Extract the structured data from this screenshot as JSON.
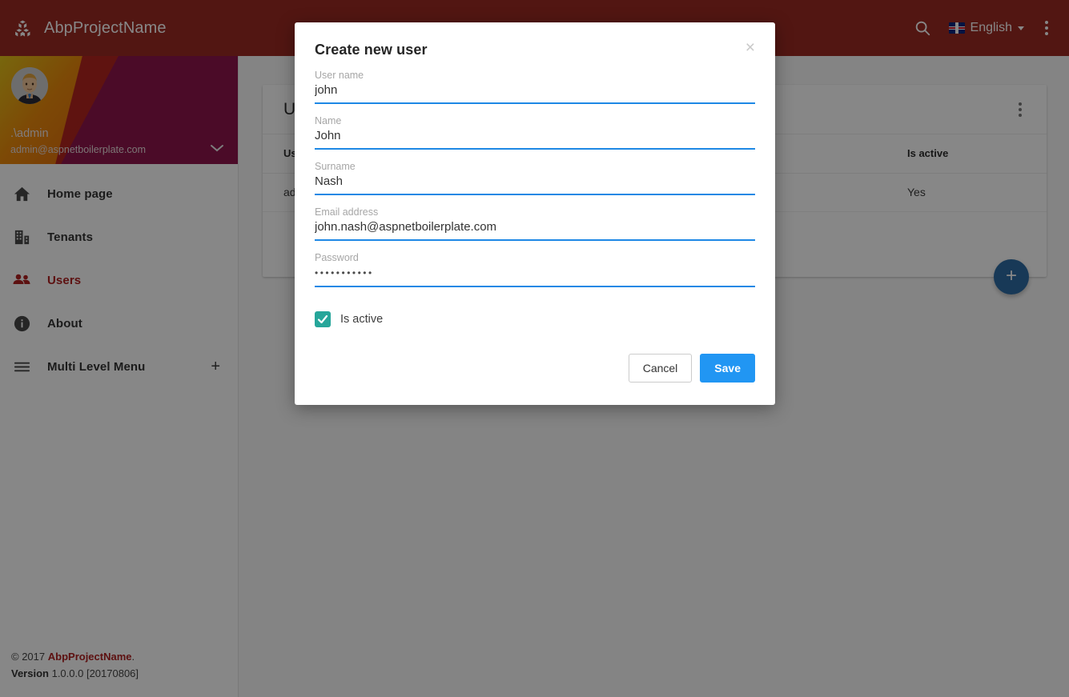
{
  "header": {
    "brand": "AbpProjectName",
    "brand_icon": "cubes-icon",
    "search_icon": "search-icon",
    "language": "English",
    "language_flag": "uk-flag-icon",
    "menu_icon": "kebab-menu-icon"
  },
  "sidebar": {
    "user": {
      "name": ".\\admin",
      "email": "admin@aspnetboilerplate.com",
      "avatar": "user-avatar",
      "expand_icon": "chevron-down-icon"
    },
    "items": [
      {
        "label": "Home page",
        "icon": "home-icon",
        "active": false
      },
      {
        "label": "Tenants",
        "icon": "building-icon",
        "active": false
      },
      {
        "label": "Users",
        "icon": "people-icon",
        "active": true
      },
      {
        "label": "About",
        "icon": "info-circle-icon",
        "active": false
      },
      {
        "label": "Multi Level Menu",
        "icon": "hamburger-icon",
        "active": false,
        "expander": "+"
      }
    ],
    "footer": {
      "copyright_prefix": "© 2017",
      "copyright_brand": "AbpProjectName",
      "copyright_suffix": ".",
      "version_label": "Version",
      "version_value": "1.0.0.0 [20170806]"
    }
  },
  "content": {
    "card_title": "Users",
    "card_menu_icon": "kebab-menu-icon",
    "fab_icon": "plus-icon",
    "table": {
      "columns": [
        "User name",
        "Is active"
      ],
      "rows": [
        {
          "user_name": "admin",
          "is_active": "Yes"
        }
      ]
    }
  },
  "modal": {
    "title": "Create new user",
    "close_icon": "close-icon",
    "fields": [
      {
        "label": "User name",
        "value": "john",
        "type": "text"
      },
      {
        "label": "Name",
        "value": "John",
        "type": "text"
      },
      {
        "label": "Surname",
        "value": "Nash",
        "type": "text"
      },
      {
        "label": "Email address",
        "value": "john.nash@aspnetboilerplate.com",
        "type": "email"
      },
      {
        "label": "Password",
        "value": "•••••••••••",
        "type": "password"
      }
    ],
    "checkbox": {
      "label": "Is active",
      "checked": true,
      "color": "#26a69a"
    },
    "buttons": {
      "cancel": "Cancel",
      "save": "Save"
    }
  },
  "colors": {
    "header_red": "#9c2a23",
    "accent_blue": "#2196f3",
    "active_nav_red": "#b02020",
    "checkbox_teal": "#26a69a",
    "fab_blue": "#2e6da4"
  }
}
